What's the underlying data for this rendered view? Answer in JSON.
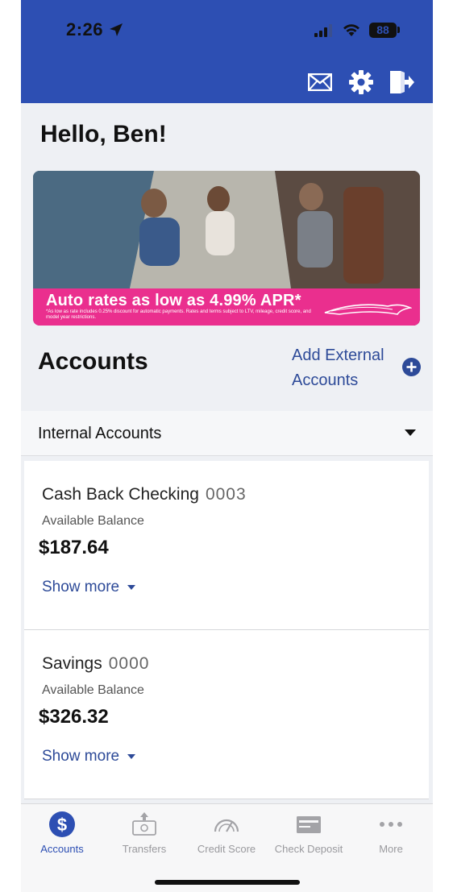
{
  "status_bar": {
    "time": "2:26",
    "battery": "88"
  },
  "header_icons": {
    "mail": "envelope-icon",
    "settings": "gear-icon",
    "logout": "logout-icon"
  },
  "greeting": "Hello, Ben!",
  "banner": {
    "headline": "Auto rates as low as 4.99% APR*",
    "fine_print": "*As low as rate includes 0.25% discount for automatic payments. Rates and terms subject to LTV, mileage, credit score, and model year restrictions."
  },
  "accounts_section": {
    "title": "Accounts",
    "add_external": "Add External Accounts"
  },
  "internal_accounts": {
    "label": "Internal Accounts",
    "accounts": [
      {
        "name": "Cash Back Checking",
        "number": "0003",
        "balance_label": "Available Balance",
        "balance": "$187.64",
        "show_more": "Show more"
      },
      {
        "name": "Savings",
        "number": "0000",
        "balance_label": "Available Balance",
        "balance": "$326.32",
        "show_more": "Show more"
      }
    ]
  },
  "tabbar": {
    "tabs": [
      {
        "label": "Accounts",
        "icon": "dollar-icon",
        "active": true
      },
      {
        "label": "Transfers",
        "icon": "transfer-icon",
        "active": false
      },
      {
        "label": "Credit Score",
        "icon": "gauge-icon",
        "active": false
      },
      {
        "label": "Check Deposit",
        "icon": "check-icon",
        "active": false
      },
      {
        "label": "More",
        "icon": "more-icon",
        "active": false
      }
    ]
  },
  "colors": {
    "brand_blue": "#2d4fb3",
    "link_blue": "#2d4a98",
    "banner_pink": "#ea2f8e"
  }
}
